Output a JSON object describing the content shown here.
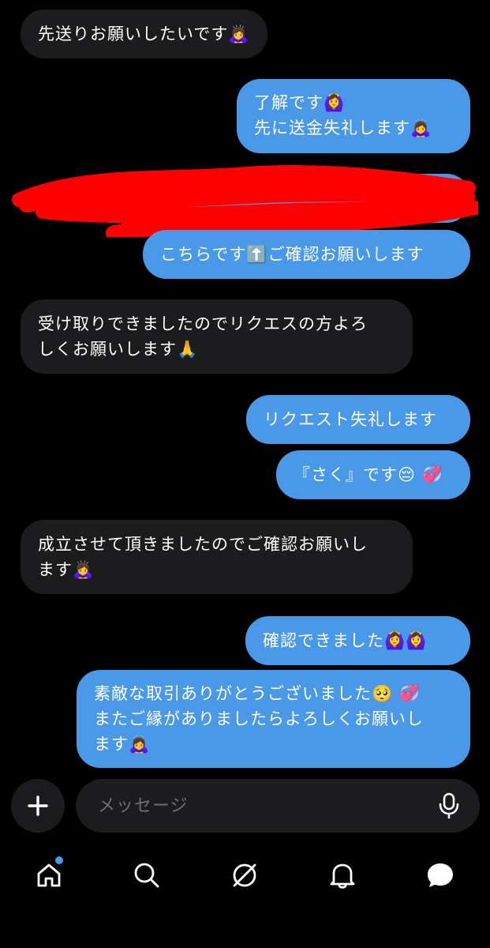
{
  "messages": [
    {
      "dir": "in",
      "text": "先送りお願いしたいです🙇‍♀️"
    },
    {
      "dir": "out",
      "text": "了解です🙆‍♀️\n先に送金失礼します🙇‍♀️"
    },
    {
      "dir": "out",
      "text": "こちらです⬆️ご確認お願いします"
    },
    {
      "dir": "in",
      "text": "受け取りできましたのでリクエスの方よろ\nしくお願いします🙏"
    },
    {
      "dir": "out",
      "text": "リクエスト失礼します"
    },
    {
      "dir": "out",
      "text": "『さく』です😔 💞"
    },
    {
      "dir": "in",
      "text": "成立させて頂きましたのでご確認お願いし\nます🙇‍♀️"
    },
    {
      "dir": "out",
      "text": "確認できました🙆‍♀️🙆‍♀️"
    },
    {
      "dir": "out",
      "text": "素敵な取引ありがとうございました🥺 💞\nまたご縁がありましたらよろしくお願いし\nます🙇‍♀️"
    }
  ],
  "composer": {
    "placeholder": "メッセージ",
    "plus_icon": "plus-icon",
    "mic_icon": "microphone-icon"
  },
  "tabs": [
    {
      "name": "home",
      "icon": "home-icon",
      "badge": true
    },
    {
      "name": "search",
      "icon": "search-icon"
    },
    {
      "name": "feeds",
      "icon": "butterfly-feed-icon"
    },
    {
      "name": "notifications",
      "icon": "bell-icon"
    },
    {
      "name": "messages",
      "icon": "chat-bubble-icon"
    }
  ],
  "colors": {
    "background": "#000000",
    "incoming_bubble": "#1c1c1e",
    "outgoing_bubble": "#4a98e8",
    "redaction": "#ff0000"
  }
}
